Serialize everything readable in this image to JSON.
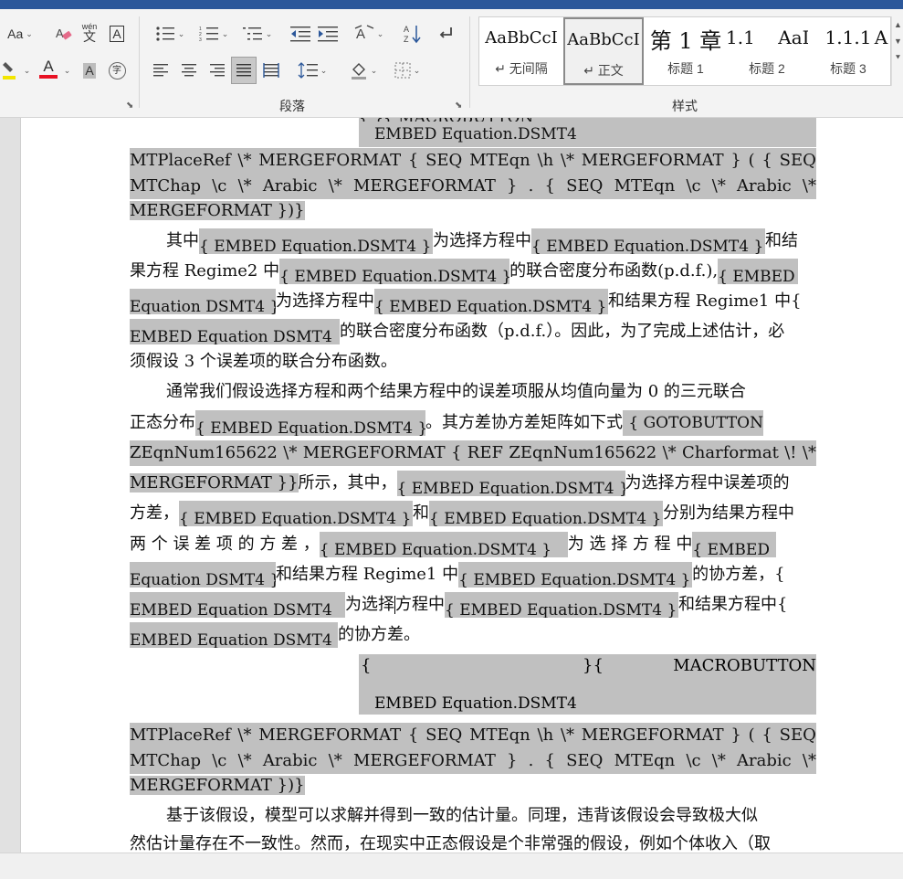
{
  "ribbon": {
    "font_size_btn": "Aa",
    "phonetic_top": "wén",
    "phonetic_bottom": "文",
    "char_border": "A",
    "font_color_letter": "A",
    "shade_letter": "A",
    "enclose_letter": "字",
    "sort_letters": "A↓",
    "paragraph_group_label": "段落",
    "styles_group_label": "样式",
    "accent_highlight": "#f3e600",
    "accent_fontcolor": "#e81123"
  },
  "styles": [
    {
      "sample": "AaBbCcI",
      "name": "↵ 无间隔"
    },
    {
      "sample": "AaBbCcI",
      "name": "↵ 正文"
    },
    {
      "sample": "第 1 章",
      "name": "标题 1"
    },
    {
      "sample": "1.1",
      "name": "标题 2"
    },
    {
      "sample": "AaI",
      "name": "标题 3"
    },
    {
      "sample": "1.1.1",
      "name": "标题 3"
    },
    {
      "sample": "A",
      "name": ""
    }
  ],
  "doc": {
    "eq_top_brace_line": "{                    }{              MACROBUTTON",
    "eq1_embed": "EMBED Equation.DSMT4",
    "eq1_l1": [
      "MTPlaceRef",
      "\\*",
      "MERGEFORMAT",
      "{",
      "SEQ",
      "MTEqn",
      "\\h",
      "\\*",
      "MERGEFORMAT",
      "}",
      "(",
      "{",
      "SEQ"
    ],
    "eq1_l2": [
      "MTChap",
      "\\c",
      "\\*",
      "Arabic",
      "\\*",
      "MERGEFORMAT",
      "}",
      ".",
      "{",
      "SEQ",
      "MTEqn",
      "\\c",
      "\\*",
      "Arabic",
      "\\*"
    ],
    "eq1_l3": "MERGEFORMAT })}",
    "embed_text": "{ EMBED Equation.DSMT4 }",
    "p1": {
      "a1": "其中",
      "a2": "为选择方程中",
      "a3": "和结",
      "b1": "果方程 Regime2 中",
      "b2": "的联合密度分布函数(p.d.f.),",
      "b3": "{ EMBED",
      "c1": "Equation DSMT4 }",
      "c2": "为选择方程中",
      "c3": "和结果方程 Regime1 中{",
      "d1": "EMBED Equation DSMT4",
      "d2": "的联合密度分布函数（p.d.f.）。因此，为了完成上述估计，必",
      "e1": "须假设 3 个误差项的联合分布函数。"
    },
    "p2": {
      "a": "通常我们假设选择方程和两个结果方程中的误差项服从均值向量为 0 的三元联合",
      "b1": "正态分布",
      "b2": "。其方差协方差矩阵如下式",
      "b3": "{ GOTOBUTTON",
      "c": [
        "ZEqnNum165622",
        "\\*",
        "MERGEFORMAT",
        "{",
        "REF",
        "ZEqnNum165622",
        "\\*",
        "Charformat",
        "\\!",
        "\\*"
      ],
      "d1": "MERGEFORMAT }}",
      "d2": "所示，其中，",
      "d3": "为选择方程中误差项的",
      "e1": "方差，",
      "e2": "和",
      "e3": "分别为结果方程中",
      "f1": "两 个 误 差 项 的 方 差 ，",
      "f2": "为 选 择 方 程 中",
      "f3": "{ EMBED",
      "g1": "Equation DSMT4 }",
      "g2": "和结果方程  Regime1  中",
      "g3": "的协方差，{",
      "h1": "EMBED Equation DSMT4",
      "h2a": "为选择",
      "h2b": "方程中",
      "h3": "和结果方程中{",
      "i1": "EMBED Equation DSMT4",
      "i2": "的协方差。"
    },
    "eq2_brace_left": "{",
    "eq2_brace_mid": "}{",
    "eq2_macro": "MACROBUTTON",
    "eq2_embed": "EMBED Equation.DSMT4",
    "p3": {
      "a": "基于该假设，模型可以求解并得到一致的估计量。同理，违背该假设会导致极大似",
      "b": "然估计量存在不一致性。然而，在现实中正态假设是个非常强的假设，例如个体收入（取"
    }
  }
}
